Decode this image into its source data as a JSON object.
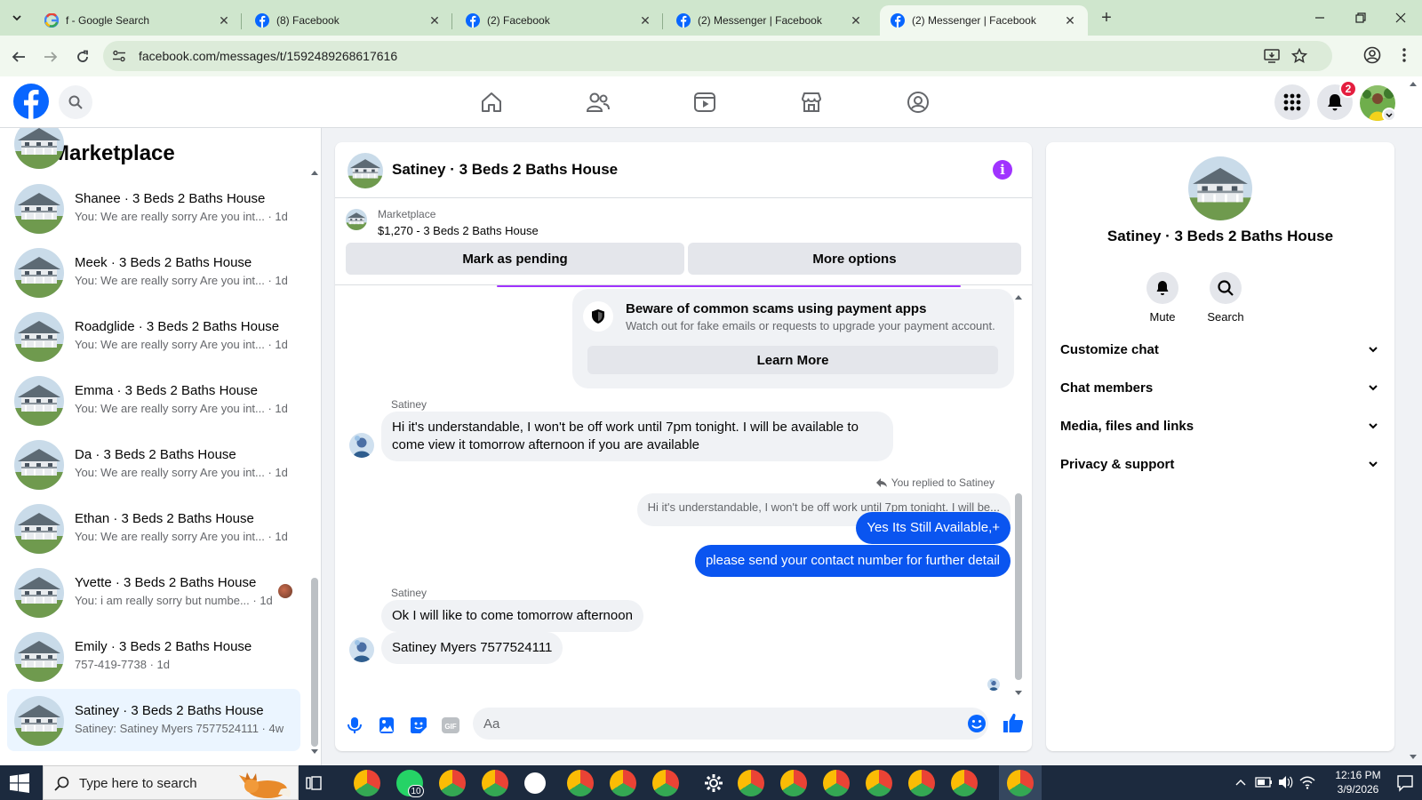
{
  "browser": {
    "tabs": [
      {
        "title": "f - Google Search",
        "favicon": "google-icon",
        "active": false
      },
      {
        "title": "(8) Facebook",
        "favicon": "facebook-icon",
        "active": false
      },
      {
        "title": "(2) Facebook",
        "favicon": "facebook-icon",
        "active": false
      },
      {
        "title": "(2) Messenger | Facebook",
        "favicon": "facebook-icon",
        "active": false
      },
      {
        "title": "(2) Messenger | Facebook",
        "favicon": "facebook-icon",
        "active": true
      }
    ],
    "url": "facebook.com/messages/t/1592489268617616"
  },
  "fbnav": {
    "notification_count": "2",
    "brand_color": "#0866ff"
  },
  "sidebar": {
    "title": "Marketplace",
    "conversations": [
      {
        "name": "Shanee · 3 Beds 2 Baths House",
        "preview": "You: We are really sorry Are you int... · 1d"
      },
      {
        "name": "Meek · 3 Beds 2 Baths House",
        "preview": "You: We are really sorry Are you int... · 1d"
      },
      {
        "name": "Roadglide · 3 Beds 2 Baths House",
        "preview": "You: We are really sorry Are you int... · 1d"
      },
      {
        "name": "Emma · 3 Beds 2 Baths House",
        "preview": "You: We are really sorry Are you int... · 1d"
      },
      {
        "name": "Da · 3 Beds 2 Baths House",
        "preview": "You: We are really sorry Are you int... · 1d"
      },
      {
        "name": "Ethan · 3 Beds 2 Baths House",
        "preview": "You: We are really sorry Are you int... · 1d"
      },
      {
        "name": "Yvette · 3 Beds 2 Baths House",
        "preview": "You: i am really sorry but numbe... · 1d"
      },
      {
        "name": "Emily · 3 Beds 2 Baths House",
        "preview": "757-419-7738 · 1d"
      },
      {
        "name": "Satiney · 3 Beds 2 Baths House",
        "preview": "Satiney: Satiney Myers 7577524111 · 4w"
      }
    ]
  },
  "chat": {
    "title": "Satiney · 3 Beds 2 Baths House",
    "listing": {
      "source": "Marketplace",
      "price_title": "$1,270 - 3 Beds 2 Baths House",
      "mark_pending": "Mark as pending",
      "more_options": "More options"
    },
    "scam_notice": {
      "title": "Beware of common scams using payment apps",
      "body": "Watch out for fake emails or requests to upgrade your payment account.",
      "button": "Learn More"
    },
    "messages": {
      "sender1": "Satiney",
      "msg1": "Hi it's understandable, I won't be off work until 7pm tonight. I will be available to come view it tomorrow afternoon if you are available",
      "replied_label": "You replied to Satiney",
      "quoted": "Hi it's understandable, I won't be off work until 7pm tonight. I will be...",
      "out1": "Yes Its Still Available,+",
      "out2": "please send your contact number for further detail",
      "sender2": "Satiney",
      "msg2": "Ok I will like to come tomorrow afternoon",
      "msg3": "Satiney Myers 7577524111"
    },
    "composer_placeholder": "Aa",
    "outgoing_color": "#0a55f0"
  },
  "info": {
    "title": "Satiney · 3 Beds 2 Baths House",
    "mute": "Mute",
    "search": "Search",
    "sections": [
      "Customize chat",
      "Chat members",
      "Media, files and links",
      "Privacy & support"
    ]
  },
  "taskbar": {
    "search_placeholder": "Type here to search",
    "whatsapp_badge": "10",
    "time": "12:16 PM",
    "date": "3/9/2026"
  }
}
